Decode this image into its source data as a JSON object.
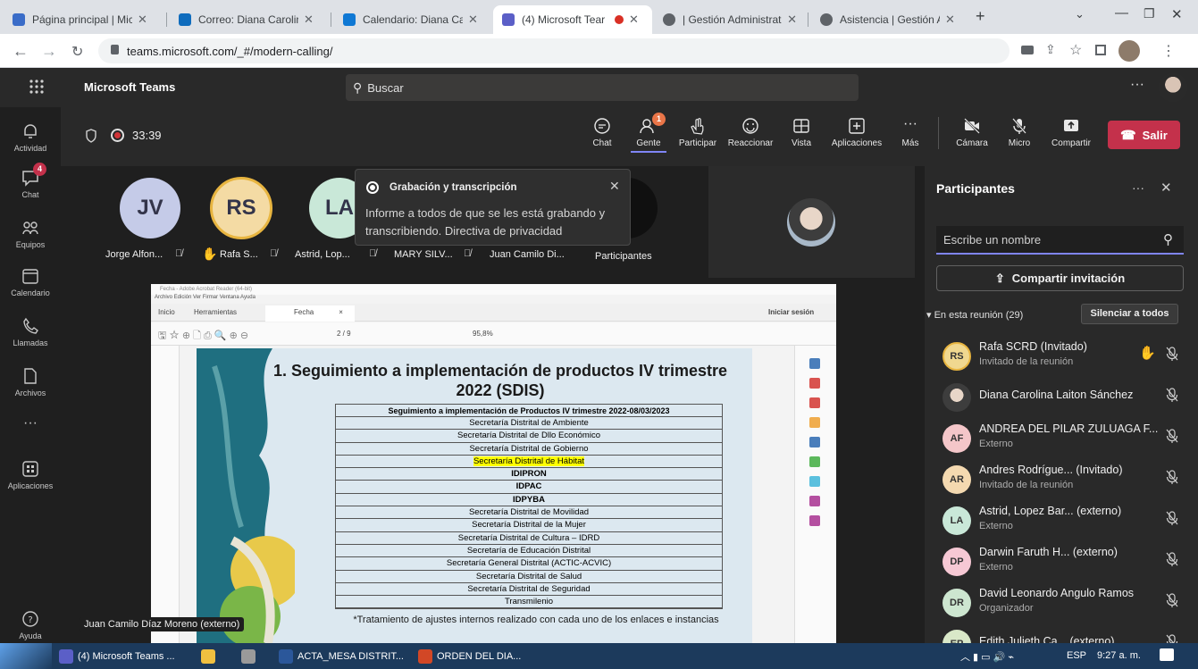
{
  "browser": {
    "tabs": [
      {
        "label": "Página principal | Micr",
        "active": false
      },
      {
        "label": "Correo: Diana Carolina",
        "active": false
      },
      {
        "label": "Calendario: Diana Car",
        "active": false
      },
      {
        "label": "(4) Microsoft Tear",
        "active": true
      },
      {
        "label": "| Gestión Administrati",
        "active": false
      },
      {
        "label": "Asistencia | Gestión A",
        "active": false
      }
    ],
    "url": "teams.microsoft.com/_#/modern-calling/"
  },
  "teams": {
    "app_title": "Microsoft Teams",
    "search_placeholder": "Buscar",
    "more": "···"
  },
  "rail": {
    "items": [
      {
        "label": "Actividad",
        "icon": "bell-icon"
      },
      {
        "label": "Chat",
        "icon": "chat-icon",
        "badge": "4"
      },
      {
        "label": "Equipos",
        "icon": "teams-icon"
      },
      {
        "label": "Calendario",
        "icon": "calendar-icon"
      },
      {
        "label": "Llamadas",
        "icon": "phone-icon"
      },
      {
        "label": "Archivos",
        "icon": "file-icon"
      },
      {
        "label": "···",
        "icon": "more-icon"
      },
      {
        "label": "Aplicaciones",
        "icon": "apps-icon"
      }
    ],
    "help_label": "Ayuda"
  },
  "meeting": {
    "timer": "33:39",
    "toolbar": {
      "chat": "Chat",
      "people": "Gente",
      "people_badge": "1",
      "raise": "Participar",
      "react": "Reaccionar",
      "view": "Vista",
      "apps": "Aplicaciones",
      "more": "Más",
      "camera": "Cámara",
      "mic": "Micro",
      "share": "Compartir",
      "leave": "Salir"
    },
    "gallery": [
      {
        "initials": "JV",
        "name": "Jorge Alfon..."
      },
      {
        "initials": "RS",
        "name": "Rafa S..."
      },
      {
        "initials": "LA",
        "name": "Astrid, Lop..."
      },
      {
        "initials": "",
        "name": "MARY SILV..."
      },
      {
        "initials": "",
        "name": "Juan Camilo Di..."
      }
    ],
    "overflow_label": "Participantes",
    "presenter_label": "Juan Camilo Díaz Moreno (externo)"
  },
  "toast": {
    "title": "Grabación y transcripción",
    "body": "Informe a todos de que se les está grabando y transcribiendo. Directiva de privacidad"
  },
  "pdf": {
    "window_title": "Fecha - Adobe Acrobat Reader (64-bit)",
    "menu": "Archivo  Edición  Ver  Firmar  Ventana  Ayuda",
    "tab_home": "Inicio",
    "tab_tools": "Herramientas",
    "tab_doc": "Fecha",
    "signin": "Iniciar sesión",
    "page_info": "2 / 9",
    "zoom": "95,8%",
    "heading_line1": "1. Seguimiento a implementación de productos IV trimestre",
    "heading_line2": "2022 (SDIS)",
    "table_header": "Seguimiento a implementación de Productos IV trimestre 2022-08/03/2023",
    "table_rows": [
      "Secretaría Distrital de Ambiente",
      "Secretaría Distrital de Dllo Económico",
      "Secretaría Distrital de Gobierno",
      "Secretaría Distrital de Hábitat",
      "IDIPRON",
      "IDPAC",
      "IDPYBA",
      "Secretaría Distrital de Movilidad",
      "Secretaría Distrital de la Mujer",
      "Secretaría Distrital de Cultura – IDRD",
      "Secretaría de Educación Distrital",
      "Secretaría General Distrital (ACTIC-ACVIC)",
      "Secretaría Distrital de Salud",
      "Secretaría Distrital de Seguridad",
      "Transmilenio"
    ],
    "highlight_row": 3,
    "footnote": "*Tratamiento de ajustes internos realizado con cada uno de los enlaces e instancias"
  },
  "participants": {
    "title": "Participantes",
    "search_placeholder": "Escribe un nombre",
    "share_invite": "Compartir invitación",
    "section": "En esta reunión (29)",
    "mute_all": "Silenciar a todos",
    "list": [
      {
        "initials": "RS",
        "name": "Rafa SCRD (Invitado)",
        "role": "Invitado de la reunión",
        "color": "#f0d890",
        "hand": true
      },
      {
        "initials": "",
        "name": "Diana Carolina Laiton Sánchez",
        "role": "",
        "color": "#555555",
        "photo": true
      },
      {
        "initials": "AF",
        "name": "ANDREA DEL PILAR ZULUAGA F...",
        "role": "Externo",
        "color": "#f4c6c9"
      },
      {
        "initials": "AR",
        "name": "Andres Rodrígue... (Invitado)",
        "role": "Invitado de la reunión",
        "color": "#f4d9b0"
      },
      {
        "initials": "LA",
        "name": "Astrid, Lopez Bar... (externo)",
        "role": "Externo",
        "color": "#c9e8d8"
      },
      {
        "initials": "DP",
        "name": "Darwin Faruth H... (externo)",
        "role": "Externo",
        "color": "#f6c8d4"
      },
      {
        "initials": "DR",
        "name": "David Leonardo Angulo Ramos",
        "role": "Organizador",
        "color": "#cde6d0"
      },
      {
        "initials": "EP",
        "name": "Edith Julieth Ca... (externo)",
        "role": "",
        "color": "#d9e8c8"
      }
    ]
  },
  "taskbar": {
    "items": [
      {
        "label": "(4) Microsoft Teams ..."
      },
      {
        "label": "ACTA_MESA DISTRIT..."
      },
      {
        "label": "ORDEN DEL DIA..."
      }
    ],
    "lang": "ESP",
    "time": "9:27 a. m."
  }
}
